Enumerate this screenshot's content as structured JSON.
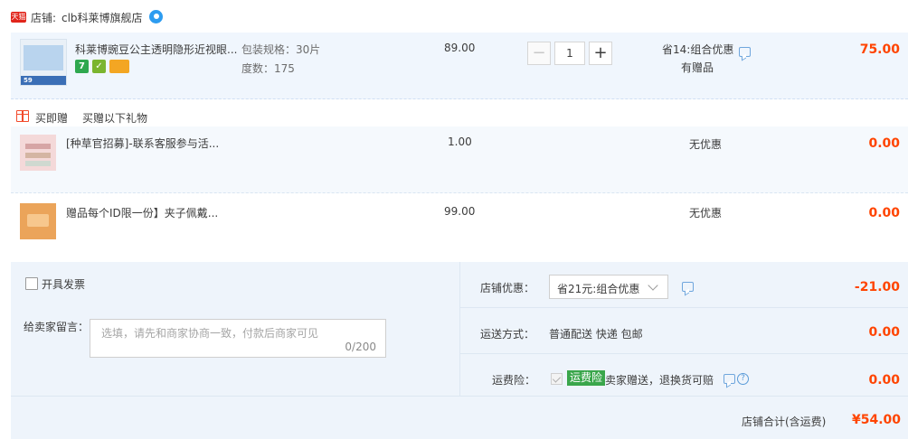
{
  "store": {
    "badge": "天猫",
    "label": "店铺:",
    "name": "clb科莱博旗舰店"
  },
  "main_item": {
    "title": "科莱博豌豆公主透明隐形近视眼...",
    "thumb_price": "59",
    "sku": [
      "包装规格：30片",
      "度数：175"
    ],
    "price": "89.00",
    "quantity": "1",
    "minus": "−",
    "plus": "+",
    "discount": "省14:组合优惠",
    "gift_note": "有赠品",
    "subtotal": "75.00"
  },
  "gift_section": {
    "title": "买即赠",
    "subtitle": "买赠以下礼物",
    "items": [
      {
        "title": "[种草官招募]-联系客服参与活...",
        "price": "1.00",
        "discount": "无优惠",
        "subtotal": "0.00"
      },
      {
        "title": "赠品每个ID限一份】夹子佩戴...",
        "price": "99.00",
        "discount": "无优惠",
        "subtotal": "0.00"
      }
    ]
  },
  "invoice": {
    "label": "开具发票"
  },
  "message": {
    "label": "给卖家留言：",
    "placeholder": "选填，请先和商家协商一致，付款后商家可见",
    "counter": "0/200"
  },
  "store_discount": {
    "label": "店铺优惠：",
    "selected": "省21元:组合优惠",
    "amount": "-21.00"
  },
  "shipping": {
    "label": "运送方式：",
    "value": "普通配送 快递 包邮",
    "amount": "0.00"
  },
  "insurance": {
    "label": "运费险：",
    "badge": "运费险",
    "text": "卖家赠送，退换货可赔",
    "amount": "0.00"
  },
  "total": {
    "label": "店铺合计(含运费)",
    "value": "¥54.00"
  },
  "colors": {
    "accent": "#ff4400",
    "row_bg": "#f0f6fd",
    "insurance_green": "#3aa64b"
  }
}
